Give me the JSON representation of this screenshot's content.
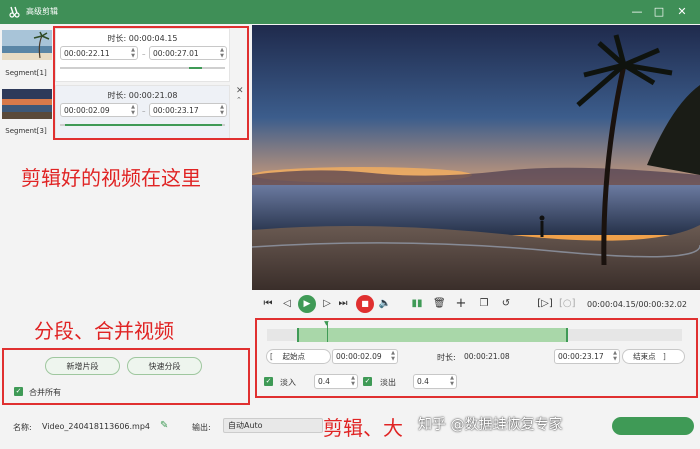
{
  "window": {
    "title": "高级剪辑",
    "icons": [
      "minimize-icon",
      "maximize-icon",
      "close-icon"
    ]
  },
  "segments": [
    {
      "caption": "Segment[1]",
      "duration": "时长:  00:00:04.15",
      "start": "00:00:22.11",
      "end": "00:00:27.01",
      "progress_from": 0.78,
      "progress_to": 0.86
    },
    {
      "caption": "Segment[3]",
      "duration": "时长:  00:00:21.08",
      "start": "00:00:02.09",
      "end": "00:00:23.17",
      "progress_from": 0.03,
      "progress_to": 0.98
    }
  ],
  "annotations": {
    "segments_note": "剪辑好的视频在这里",
    "split_merge_note": "分段、合并视频",
    "trim_note": "剪辑、大"
  },
  "buttons": {
    "new_segment": "新增片段",
    "quick_split": "快速分段",
    "merge_all": "合并所有"
  },
  "player": {
    "time_readout": "00:00:04.15/00:00:32.02"
  },
  "trim": {
    "start_label": "起始点",
    "start_value": "00:00:02.09",
    "length_label": "时长:",
    "length_value": "00:00:21.08",
    "end_value": "00:00:23.17",
    "end_label": "结束点",
    "fade_in_label": "淡入",
    "fade_in_value": "0.4",
    "fade_out_label": "淡出",
    "fade_out_value": "0.4",
    "range_from": 0.073,
    "range_to": 0.725,
    "playhead": 0.145
  },
  "footer": {
    "name_label": "名称:",
    "file_name": "Video_240418113606.mp4",
    "output_label": "输出:",
    "output_value": "自动Auto",
    "watermark": "知乎 @数据蛙恢复专家"
  },
  "colors": {
    "brand": "#3f8f57",
    "accent_green": "#3f9a56",
    "annotation_red": "#e02424"
  }
}
